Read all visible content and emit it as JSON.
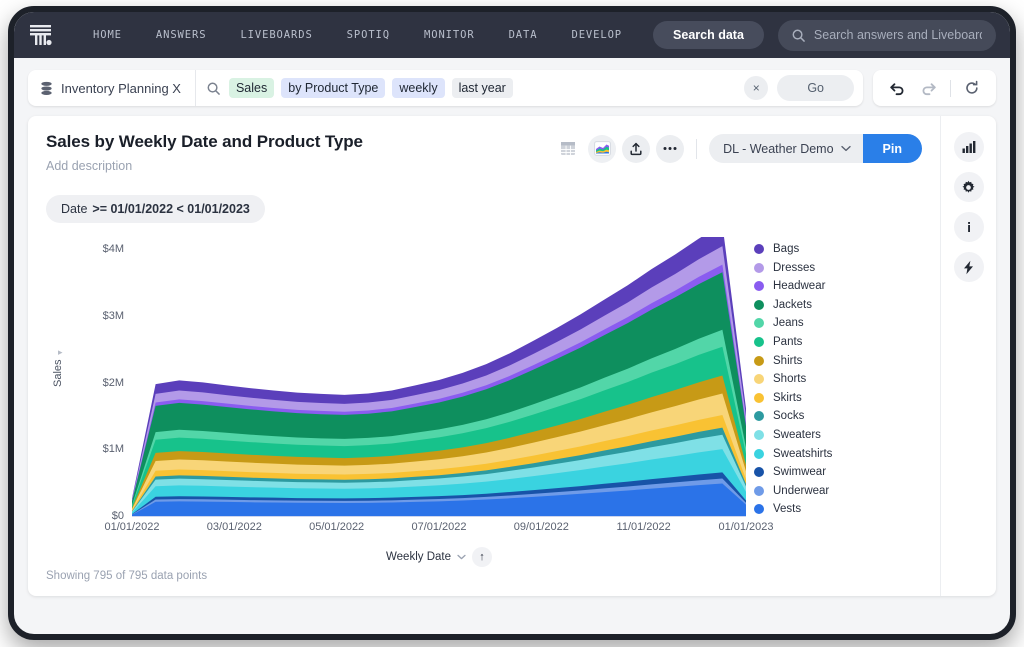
{
  "topnav": {
    "logo_icon": "thoughtspot-logo-icon",
    "links": [
      "HOME",
      "ANSWERS",
      "LIVEBOARDS",
      "SPOTIQ",
      "MONITOR",
      "DATA",
      "DEVELOP"
    ],
    "search_data_label": "Search data",
    "global_search_placeholder": "Search answers and Liveboards",
    "search_icon": "search-icon"
  },
  "searchbar": {
    "source_icon": "database-icon",
    "source_label": "Inventory Planning X",
    "search_icon": "search-icon",
    "tokens": [
      {
        "label": "Sales",
        "style": "green"
      },
      {
        "label": "by Product Type",
        "style": "blue"
      },
      {
        "label": "weekly",
        "style": "blue"
      },
      {
        "label": "last year",
        "style": "gray"
      }
    ],
    "clear_label": "×",
    "go_label": "Go",
    "undo_icon": "undo-arrow-icon",
    "redo_icon": "redo-arrow-icon",
    "reset_icon": "reset-circle-icon"
  },
  "card": {
    "title": "Sales by Weekly Date and Product Type",
    "description": "Add description",
    "table_icon": "table-view-icon",
    "chart_icon": "area-chart-view-icon",
    "share_icon": "share-upload-icon",
    "more_icon": "more-horizontal-icon",
    "liveboard_label": "DL - Weather Demo",
    "chevron_icon": "chevron-down-icon",
    "pin_label": "Pin",
    "pin_color": "#2a7fe8",
    "filter_prefix": "Date",
    "filter_value": ">= 01/01/2022 < 01/01/2023",
    "footnote": "Showing 795 of 795 data points",
    "sidebar_icons": [
      "bar-chart-icon",
      "gear-icon",
      "info-icon",
      "lightning-bolt-icon"
    ]
  },
  "chart_data": {
    "type": "area",
    "title": "Sales by Weekly Date and Product Type",
    "stacked": true,
    "xlabel": "Weekly Date",
    "ylabel": "Sales",
    "ylim": [
      0,
      4200000
    ],
    "yticks": [
      "$0",
      "$1M",
      "$2M",
      "$3M",
      "$4M"
    ],
    "ytick_values": [
      0,
      1000000,
      2000000,
      3000000,
      4000000
    ],
    "xticks": [
      "01/01/2022",
      "03/01/2022",
      "05/01/2022",
      "07/01/2022",
      "09/01/2022",
      "11/01/2022",
      "01/01/2023"
    ],
    "x": [
      0,
      1,
      2,
      3,
      4,
      5,
      6,
      7,
      8,
      9,
      10,
      11,
      12,
      13,
      14,
      15,
      16,
      17,
      18,
      19,
      20,
      21,
      22,
      23,
      24,
      25,
      26
    ],
    "grid": false,
    "legend_position": "right",
    "sort_indicator": "ascending",
    "series": [
      {
        "name": "Bags",
        "color": "#5b3fbb",
        "values": [
          20000,
          148000,
          152000,
          150000,
          146000,
          143000,
          140000,
          138000,
          136000,
          135000,
          136000,
          140000,
          146000,
          152000,
          160000,
          170000,
          182000,
          196000,
          210000,
          226000,
          242000,
          258000,
          276000,
          292000,
          310000,
          326000,
          120000
        ]
      },
      {
        "name": "Dresses",
        "color": "#b39ae8",
        "values": [
          18000,
          128000,
          132000,
          130000,
          127000,
          124000,
          122000,
          120000,
          119000,
          118000,
          119000,
          122000,
          127000,
          132000,
          139000,
          147000,
          157000,
          168000,
          180000,
          193000,
          206000,
          220000,
          235000,
          249000,
          264000,
          278000,
          104000
        ]
      },
      {
        "name": "Headwear",
        "color": "#8a5cf0",
        "values": [
          8000,
          52000,
          54000,
          53000,
          52000,
          51000,
          50000,
          49000,
          49000,
          48000,
          49000,
          50000,
          52000,
          54000,
          57000,
          60000,
          64000,
          69000,
          74000,
          79000,
          84000,
          90000,
          96000,
          102000,
          108000,
          114000,
          43000
        ]
      },
      {
        "name": "Jackets",
        "color": "#0e8f5e",
        "values": [
          55000,
          392000,
          402000,
          396000,
          387000,
          379000,
          372000,
          366000,
          362000,
          360000,
          363000,
          372000,
          387000,
          403000,
          424000,
          450000,
          482000,
          519000,
          557000,
          598000,
          641000,
          684000,
          731000,
          774000,
          821000,
          864000,
          320000
        ]
      },
      {
        "name": "Jeans",
        "color": "#52d6a8",
        "values": [
          16000,
          116000,
          119000,
          117000,
          115000,
          112000,
          110000,
          108000,
          107000,
          107000,
          108000,
          110000,
          115000,
          119000,
          126000,
          133000,
          142000,
          153000,
          164000,
          176000,
          189000,
          201000,
          215000,
          228000,
          242000,
          254000,
          95000
        ]
      },
      {
        "name": "Pants",
        "color": "#17c28b",
        "values": [
          28000,
          196000,
          201000,
          198000,
          194000,
          190000,
          186000,
          183000,
          181000,
          180000,
          182000,
          186000,
          194000,
          202000,
          212000,
          225000,
          241000,
          260000,
          279000,
          299000,
          321000,
          342000,
          366000,
          387000,
          411000,
          432000,
          160000
        ]
      },
      {
        "name": "Shirts",
        "color": "#c79a16",
        "values": [
          17000,
          122000,
          126000,
          124000,
          121000,
          119000,
          117000,
          115000,
          113000,
          113000,
          114000,
          117000,
          121000,
          126000,
          133000,
          141000,
          151000,
          163000,
          175000,
          187000,
          201000,
          214000,
          229000,
          242000,
          257000,
          270000,
          100000
        ]
      },
      {
        "name": "Shorts",
        "color": "#f8d578",
        "values": [
          20000,
          146000,
          150000,
          148000,
          145000,
          142000,
          139000,
          137000,
          135000,
          134000,
          136000,
          139000,
          145000,
          151000,
          158000,
          168000,
          180000,
          194000,
          208000,
          223000,
          239000,
          255000,
          273000,
          289000,
          306000,
          322000,
          119000
        ]
      },
      {
        "name": "Skirts",
        "color": "#f9c233",
        "values": [
          12000,
          86000,
          88000,
          87000,
          85000,
          83000,
          82000,
          80000,
          80000,
          79000,
          80000,
          82000,
          85000,
          89000,
          93000,
          99000,
          106000,
          114000,
          122000,
          131000,
          141000,
          150000,
          160000,
          170000,
          180000,
          189000,
          70000
        ]
      },
      {
        "name": "Socks",
        "color": "#2d9aa0",
        "values": [
          7000,
          48000,
          50000,
          49000,
          48000,
          47000,
          46000,
          45000,
          45000,
          44000,
          45000,
          46000,
          48000,
          50000,
          53000,
          56000,
          60000,
          64000,
          69000,
          74000,
          79000,
          85000,
          91000,
          96000,
          102000,
          107000,
          40000
        ]
      },
      {
        "name": "Sweaters",
        "color": "#7fe0e6",
        "values": [
          14000,
          98000,
          101000,
          99000,
          97000,
          95000,
          93000,
          92000,
          91000,
          90000,
          91000,
          93000,
          97000,
          101000,
          106000,
          113000,
          121000,
          130000,
          140000,
          150000,
          161000,
          172000,
          183000,
          194000,
          206000,
          216000,
          80000
        ]
      },
      {
        "name": "Sweatshirts",
        "color": "#3ad3e0",
        "values": [
          22000,
          158000,
          162000,
          160000,
          157000,
          153000,
          150000,
          148000,
          146000,
          145000,
          147000,
          150000,
          157000,
          163000,
          172000,
          182000,
          195000,
          210000,
          225000,
          241000,
          259000,
          276000,
          295000,
          312000,
          331000,
          348000,
          129000
        ]
      },
      {
        "name": "Swimwear",
        "color": "#1853a8",
        "values": [
          6000,
          42000,
          43000,
          42000,
          41000,
          41000,
          40000,
          39000,
          39000,
          38000,
          39000,
          40000,
          41000,
          43000,
          45000,
          48000,
          52000,
          56000,
          60000,
          64000,
          69000,
          73000,
          78000,
          83000,
          88000,
          92000,
          34000
        ]
      },
      {
        "name": "Underwear",
        "color": "#6f9be8",
        "values": [
          5000,
          34000,
          35000,
          35000,
          34000,
          33000,
          33000,
          32000,
          32000,
          31000,
          32000,
          33000,
          34000,
          35000,
          37000,
          39000,
          42000,
          45000,
          49000,
          52000,
          56000,
          60000,
          64000,
          68000,
          72000,
          75000,
          28000
        ]
      },
      {
        "name": "Vests",
        "color": "#2b73e8",
        "values": [
          32000,
          228000,
          234000,
          231000,
          226000,
          221000,
          217000,
          213000,
          211000,
          210000,
          212000,
          217000,
          226000,
          235000,
          247000,
          262000,
          281000,
          302000,
          325000,
          348000,
          373000,
          398000,
          426000,
          451000,
          478000,
          503000,
          186000
        ]
      }
    ]
  }
}
